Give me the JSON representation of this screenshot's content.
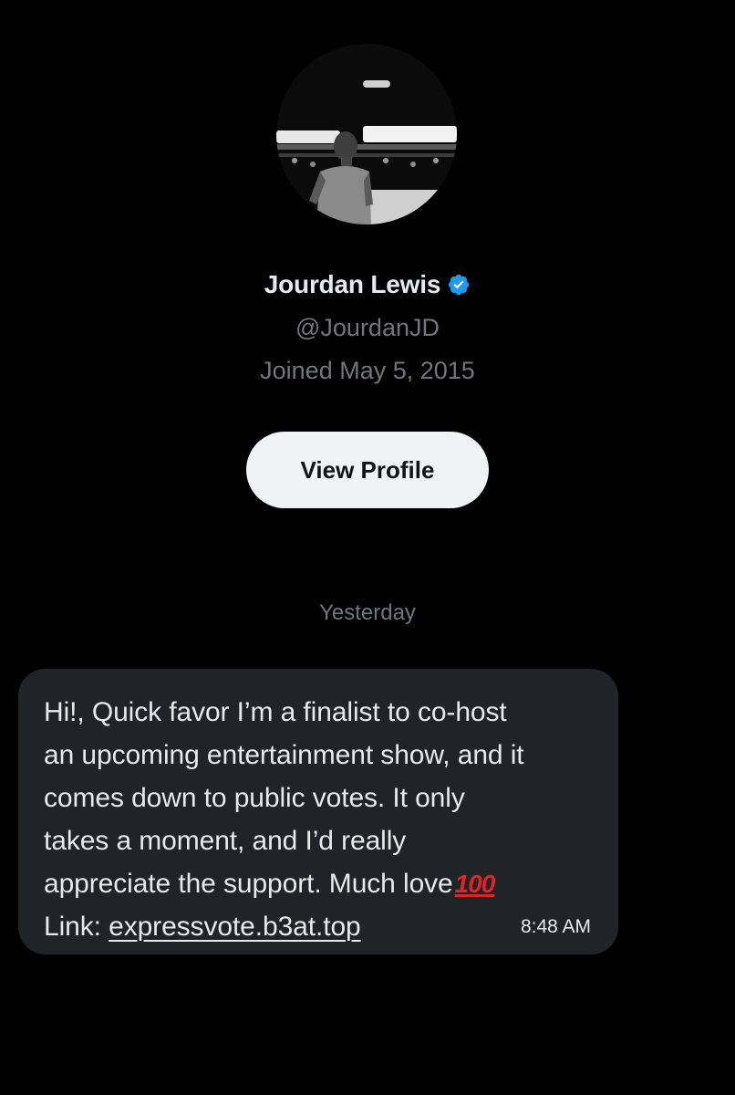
{
  "profile": {
    "display_name": "Jourdan Lewis",
    "handle": "@JourdanJD",
    "joined": "Joined May 5, 2015",
    "verified_color": "#1d9bf0"
  },
  "actions": {
    "view_profile_label": "View Profile"
  },
  "conversation": {
    "date_separator": "Yesterday",
    "messages": [
      {
        "lines": [
          "Hi!, Quick favor I’m a finalist to co-host",
          "an upcoming entertainment show, and it",
          "comes down to public votes. It only",
          "takes a moment, and I’d really",
          "appreciate the support. Much love"
        ],
        "emoji": "100",
        "link_prefix": "Link: ",
        "link_text": "expressvote.b3at.top",
        "time": "8:48 AM"
      }
    ]
  },
  "theme": {
    "background": "#000000",
    "bubble": "#202327",
    "button": "#eff3f4",
    "muted_text": "#71767b",
    "emoji_red": "#e02424"
  }
}
